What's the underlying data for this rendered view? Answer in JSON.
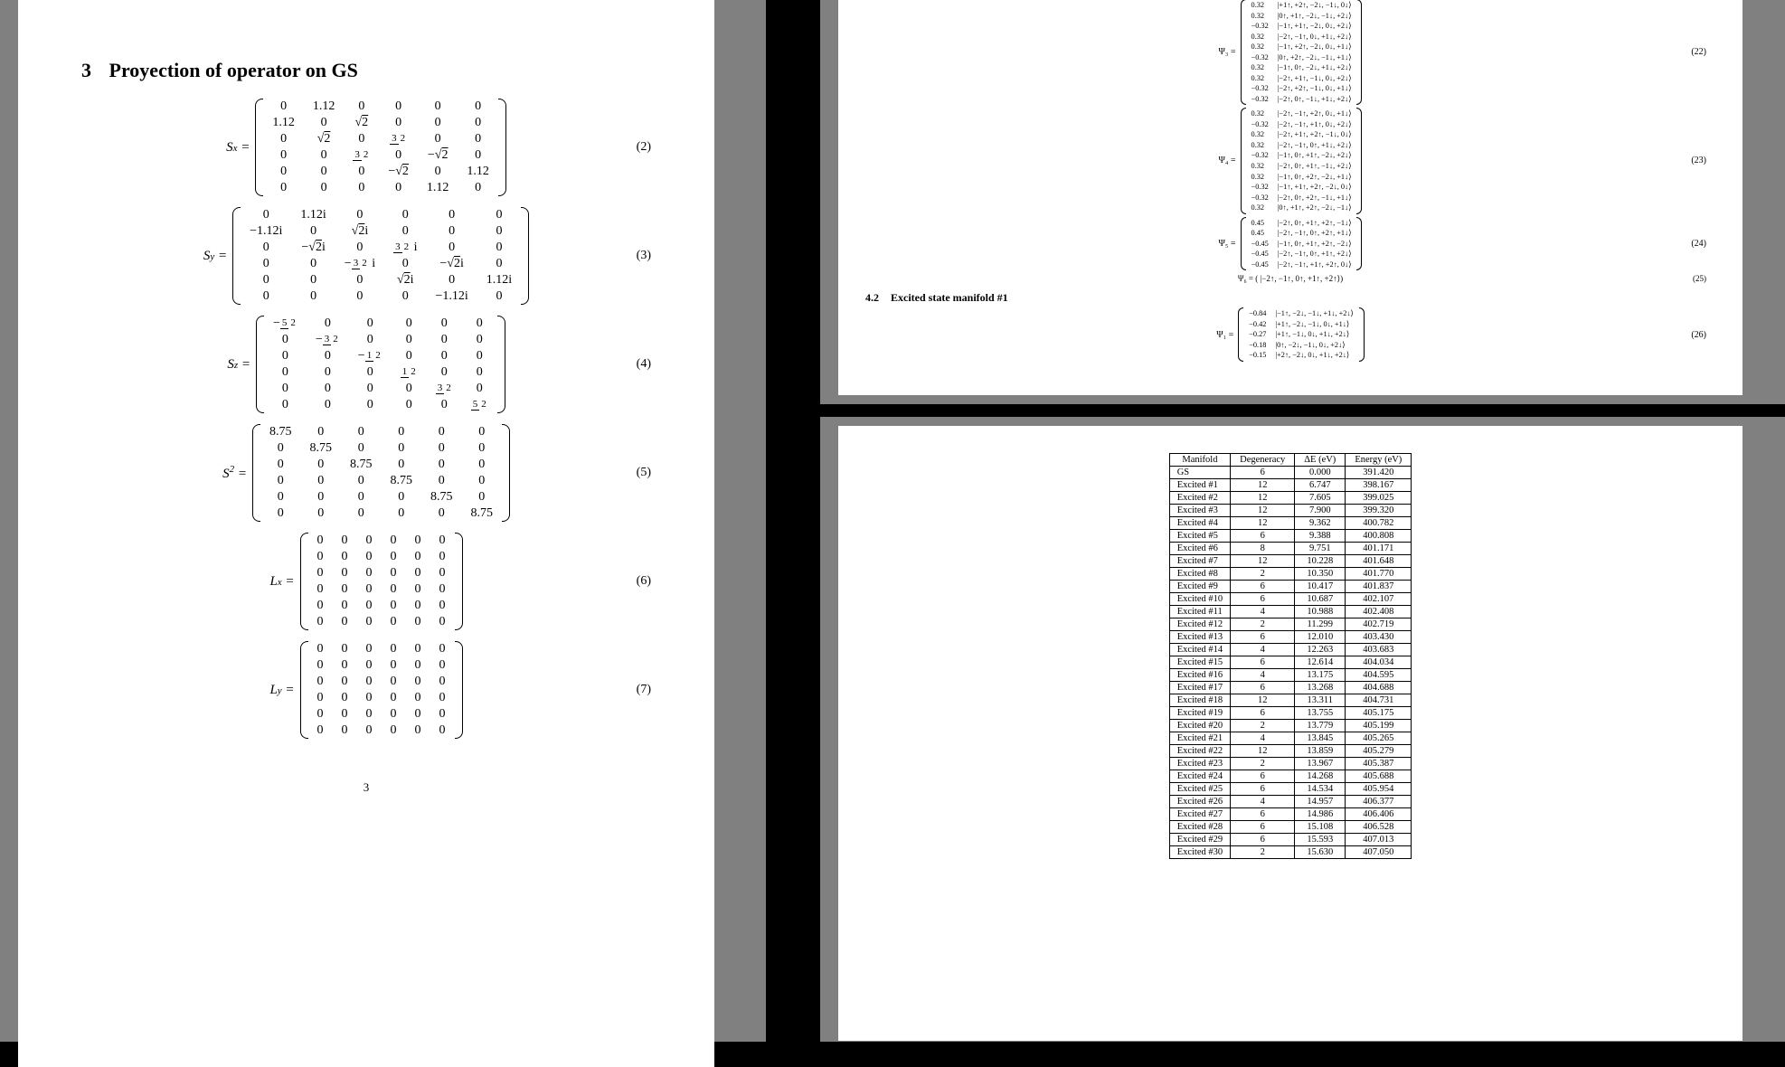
{
  "left": {
    "section_num": "3",
    "section_title": "Proyection of operator on GS",
    "page_number": "3",
    "equations": [
      {
        "label": "S",
        "sub": "x",
        "eqno": "(2)",
        "rows": [
          [
            "0",
            "1.12",
            "0",
            "0",
            "0",
            "0"
          ],
          [
            "1.12",
            "0",
            "√2",
            "0",
            "0",
            "0"
          ],
          [
            "0",
            "√2",
            "0",
            "3/2",
            "0",
            "0"
          ],
          [
            "0",
            "0",
            "3/2",
            "0",
            "−√2",
            "0"
          ],
          [
            "0",
            "0",
            "0",
            "−√2",
            "0",
            "1.12"
          ],
          [
            "0",
            "0",
            "0",
            "0",
            "1.12",
            "0"
          ]
        ]
      },
      {
        "label": "S",
        "sub": "y",
        "eqno": "(3)",
        "rows": [
          [
            "0",
            "1.12i",
            "0",
            "0",
            "0",
            "0"
          ],
          [
            "−1.12i",
            "0",
            "√2i",
            "0",
            "0",
            "0"
          ],
          [
            "0",
            "−√2i",
            "0",
            "3/2 i",
            "0",
            "0"
          ],
          [
            "0",
            "0",
            "−3/2 i",
            "0",
            "−√2i",
            "0"
          ],
          [
            "0",
            "0",
            "0",
            "√2i",
            "0",
            "1.12i"
          ],
          [
            "0",
            "0",
            "0",
            "0",
            "−1.12i",
            "0"
          ]
        ]
      },
      {
        "label": "S",
        "sub": "z",
        "eqno": "(4)",
        "rows": [
          [
            "−5/2",
            "0",
            "0",
            "0",
            "0",
            "0"
          ],
          [
            "0",
            "−3/2",
            "0",
            "0",
            "0",
            "0"
          ],
          [
            "0",
            "0",
            "−1/2",
            "0",
            "0",
            "0"
          ],
          [
            "0",
            "0",
            "0",
            "1/2",
            "0",
            "0"
          ],
          [
            "0",
            "0",
            "0",
            "0",
            "3/2",
            "0"
          ],
          [
            "0",
            "0",
            "0",
            "0",
            "0",
            "5/2"
          ]
        ]
      },
      {
        "label": "S",
        "sup": "2",
        "eqno": "(5)",
        "rows": [
          [
            "8.75",
            "0",
            "0",
            "0",
            "0",
            "0"
          ],
          [
            "0",
            "8.75",
            "0",
            "0",
            "0",
            "0"
          ],
          [
            "0",
            "0",
            "8.75",
            "0",
            "0",
            "0"
          ],
          [
            "0",
            "0",
            "0",
            "8.75",
            "0",
            "0"
          ],
          [
            "0",
            "0",
            "0",
            "0",
            "8.75",
            "0"
          ],
          [
            "0",
            "0",
            "0",
            "0",
            "0",
            "8.75"
          ]
        ]
      },
      {
        "label": "L",
        "sub": "x",
        "eqno": "(6)",
        "rows": [
          [
            "0",
            "0",
            "0",
            "0",
            "0",
            "0"
          ],
          [
            "0",
            "0",
            "0",
            "0",
            "0",
            "0"
          ],
          [
            "0",
            "0",
            "0",
            "0",
            "0",
            "0"
          ],
          [
            "0",
            "0",
            "0",
            "0",
            "0",
            "0"
          ],
          [
            "0",
            "0",
            "0",
            "0",
            "0",
            "0"
          ],
          [
            "0",
            "0",
            "0",
            "0",
            "0",
            "0"
          ]
        ]
      },
      {
        "label": "L",
        "sub": "y",
        "eqno": "(7)",
        "rows": [
          [
            "0",
            "0",
            "0",
            "0",
            "0",
            "0"
          ],
          [
            "0",
            "0",
            "0",
            "0",
            "0",
            "0"
          ],
          [
            "0",
            "0",
            "0",
            "0",
            "0",
            "0"
          ],
          [
            "0",
            "0",
            "0",
            "0",
            "0",
            "0"
          ],
          [
            "0",
            "0",
            "0",
            "0",
            "0",
            "0"
          ],
          [
            "0",
            "0",
            "0",
            "0",
            "0",
            "0"
          ]
        ]
      }
    ]
  },
  "top_right": {
    "psis": [
      {
        "label": "Ψ₃ =",
        "eqno": "(22)",
        "rows": [
          [
            "0.32",
            "|+1↑, +2↑, −2↓, −1↓, 0↓⟩"
          ],
          [
            "0.32",
            "|0↑, +1↑, −2↓, −1↓, +2↓⟩"
          ],
          [
            "−0.32",
            "|−1↑, +1↑, −2↓, 0↓, +2↓⟩"
          ],
          [
            "0.32",
            "|−2↑, −1↑, 0↓, +1↓, +2↓⟩"
          ],
          [
            "0.32",
            "|−1↑, +2↑, −2↓, 0↓, +1↓⟩"
          ],
          [
            "−0.32",
            "|0↑, +2↑, −2↓, −1↓, +1↓⟩"
          ],
          [
            "0.32",
            "|−1↑, 0↑, −2↓, +1↓, +2↓⟩"
          ],
          [
            "0.32",
            "|−2↑, +1↑, −1↓, 0↓, +2↓⟩"
          ],
          [
            "−0.32",
            "|−2↑, +2↑, −1↓, 0↓, +1↓⟩"
          ],
          [
            "−0.32",
            "|−2↑, 0↑, −1↓, +1↓, +2↓⟩"
          ]
        ]
      },
      {
        "label": "Ψ₄ =",
        "eqno": "(23)",
        "rows": [
          [
            "0.32",
            "|−2↑, −1↑, +2↑, 0↓, +1↓⟩"
          ],
          [
            "−0.32",
            "|−2↑, −1↑, +1↑, 0↓, +2↓⟩"
          ],
          [
            "0.32",
            "|−2↑, +1↑, +2↑, −1↓, 0↓⟩"
          ],
          [
            "0.32",
            "|−2↑, −1↑, 0↑, +1↓, +2↓⟩"
          ],
          [
            "−0.32",
            "|−1↑, 0↑, +1↑, −2↓, +2↓⟩"
          ],
          [
            "0.32",
            "|−2↑, 0↑, +1↑, −1↓, +2↓⟩"
          ],
          [
            "0.32",
            "|−1↑, 0↑, +2↑, −2↓, +1↓⟩"
          ],
          [
            "−0.32",
            "|−1↑, +1↑, +2↑, −2↓, 0↓⟩"
          ],
          [
            "−0.32",
            "|−2↑, 0↑, +2↑, −1↓, +1↓⟩"
          ],
          [
            "0.32",
            "|0↑, +1↑, +2↑, −2↓, −1↓⟩"
          ]
        ]
      },
      {
        "label": "Ψ₅ =",
        "eqno": "(24)",
        "rows": [
          [
            "0.45",
            "|−2↑, 0↑, +1↑, +2↑, −1↓⟩"
          ],
          [
            "0.45",
            "|−2↑, −1↑, 0↑, +2↑, +1↓⟩"
          ],
          [
            "−0.45",
            "|−1↑, 0↑, +1↑, +2↑, −2↓⟩"
          ],
          [
            "−0.45",
            "|−2↑, −1↑, 0↑, +1↑, +2↓⟩"
          ],
          [
            "−0.45",
            "|−2↑, −1↑, +1↑, +2↑, 0↓⟩"
          ]
        ]
      }
    ],
    "single": {
      "label": "Ψ₆ = (  |−2↑, −1↑, 0↑, +1↑, +2↑⟩)",
      "eqno": "(25)"
    },
    "subsection_num": "4.2",
    "subsection_title": "Excited state manifold #1",
    "psi_excited": {
      "label": "Ψ₁ =",
      "eqno": "(26)",
      "rows": [
        [
          "−0.84",
          "|−1↑, −2↓, −1↓, +1↓, +2↓⟩"
        ],
        [
          "−0.42",
          "|+1↑, −2↓, −1↓, 0↓, +1↓⟩"
        ],
        [
          "−0.27",
          "|+1↑, −1↓, 0↓, +1↓, +2↓⟩"
        ],
        [
          "−0.18",
          "|0↑, −2↓, −1↓, 0↓, +2↓⟩"
        ],
        [
          "−0.15",
          "|+2↑, −2↓, 0↓, +1↓, +2↓⟩"
        ]
      ]
    }
  },
  "bottom_right": {
    "headers": [
      "Manifold",
      "Degeneracy",
      "ΔE (eV)",
      "Energy (eV)"
    ],
    "rows": [
      [
        "GS",
        "6",
        "0.000",
        "391.420"
      ],
      [
        "Excited #1",
        "12",
        "6.747",
        "398.167"
      ],
      [
        "Excited #2",
        "12",
        "7.605",
        "399.025"
      ],
      [
        "Excited #3",
        "12",
        "7.900",
        "399.320"
      ],
      [
        "Excited #4",
        "12",
        "9.362",
        "400.782"
      ],
      [
        "Excited #5",
        "6",
        "9.388",
        "400.808"
      ],
      [
        "Excited #6",
        "8",
        "9.751",
        "401.171"
      ],
      [
        "Excited #7",
        "12",
        "10.228",
        "401.648"
      ],
      [
        "Excited #8",
        "2",
        "10.350",
        "401.770"
      ],
      [
        "Excited #9",
        "6",
        "10.417",
        "401.837"
      ],
      [
        "Excited #10",
        "6",
        "10.687",
        "402.107"
      ],
      [
        "Excited #11",
        "4",
        "10.988",
        "402.408"
      ],
      [
        "Excited #12",
        "2",
        "11.299",
        "402.719"
      ],
      [
        "Excited #13",
        "6",
        "12.010",
        "403.430"
      ],
      [
        "Excited #14",
        "4",
        "12.263",
        "403.683"
      ],
      [
        "Excited #15",
        "6",
        "12.614",
        "404.034"
      ],
      [
        "Excited #16",
        "4",
        "13.175",
        "404.595"
      ],
      [
        "Excited #17",
        "6",
        "13.268",
        "404.688"
      ],
      [
        "Excited #18",
        "12",
        "13.311",
        "404.731"
      ],
      [
        "Excited #19",
        "6",
        "13.755",
        "405.175"
      ],
      [
        "Excited #20",
        "2",
        "13.779",
        "405.199"
      ],
      [
        "Excited #21",
        "4",
        "13.845",
        "405.265"
      ],
      [
        "Excited #22",
        "12",
        "13.859",
        "405.279"
      ],
      [
        "Excited #23",
        "2",
        "13.967",
        "405.387"
      ],
      [
        "Excited #24",
        "6",
        "14.268",
        "405.688"
      ],
      [
        "Excited #25",
        "6",
        "14.534",
        "405.954"
      ],
      [
        "Excited #26",
        "4",
        "14.957",
        "406.377"
      ],
      [
        "Excited #27",
        "6",
        "14.986",
        "406.406"
      ],
      [
        "Excited #28",
        "6",
        "15.108",
        "406.528"
      ],
      [
        "Excited #29",
        "6",
        "15.593",
        "407.013"
      ],
      [
        "Excited #30",
        "2",
        "15.630",
        "407.050"
      ]
    ]
  }
}
